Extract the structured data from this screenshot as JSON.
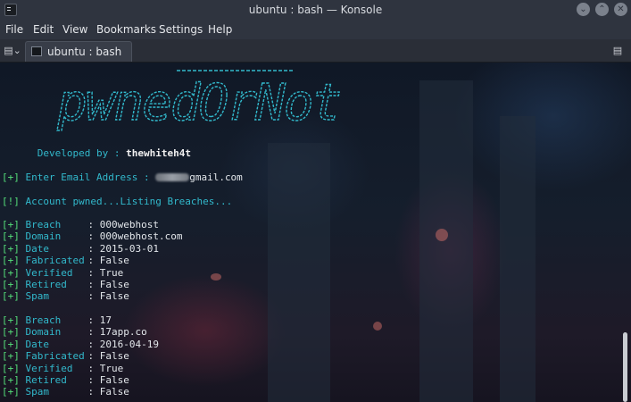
{
  "window": {
    "title": "ubuntu : bash — Konsole"
  },
  "menu": [
    "File",
    "Edit",
    "View",
    "Bookmarks",
    "Settings",
    "Help"
  ],
  "tab": {
    "label": "ubuntu : bash"
  },
  "banner": {
    "text": "pwnedOrNot",
    "color": "#32b9cc"
  },
  "terminal": {
    "developed_label": "Developed by :",
    "developer": "thewhiteh4t",
    "email_prompt_tag": "[+]",
    "email_prompt": "Enter Email Address :",
    "email_visible": "gmail.com",
    "pwned_tag": "[!]",
    "pwned_message": "Account pwned...Listing Breaches...",
    "breaches": [
      {
        "fields": [
          {
            "tag": "[+]",
            "key": "Breach",
            "value": "000webhost"
          },
          {
            "tag": "[+]",
            "key": "Domain",
            "value": "000webhost.com"
          },
          {
            "tag": "[+]",
            "key": "Date",
            "value": "2015-03-01"
          },
          {
            "tag": "[+]",
            "key": "Fabricated",
            "value": "False"
          },
          {
            "tag": "[+]",
            "key": "Verified",
            "value": "True"
          },
          {
            "tag": "[+]",
            "key": "Retired",
            "value": "False"
          },
          {
            "tag": "[+]",
            "key": "Spam",
            "value": "False"
          }
        ]
      },
      {
        "fields": [
          {
            "tag": "[+]",
            "key": "Breach",
            "value": "17"
          },
          {
            "tag": "[+]",
            "key": "Domain",
            "value": "17app.co"
          },
          {
            "tag": "[+]",
            "key": "Date",
            "value": "2016-04-19"
          },
          {
            "tag": "[+]",
            "key": "Fabricated",
            "value": "False"
          },
          {
            "tag": "[+]",
            "key": "Verified",
            "value": "True"
          },
          {
            "tag": "[+]",
            "key": "Retired",
            "value": "False"
          },
          {
            "tag": "[+]",
            "key": "Spam",
            "value": "False"
          }
        ]
      }
    ]
  },
  "colors": {
    "tag_green": "#55e07a",
    "key_cyan": "#32b9cc",
    "text": "#e2e6ea",
    "chrome": "#2f343f"
  }
}
